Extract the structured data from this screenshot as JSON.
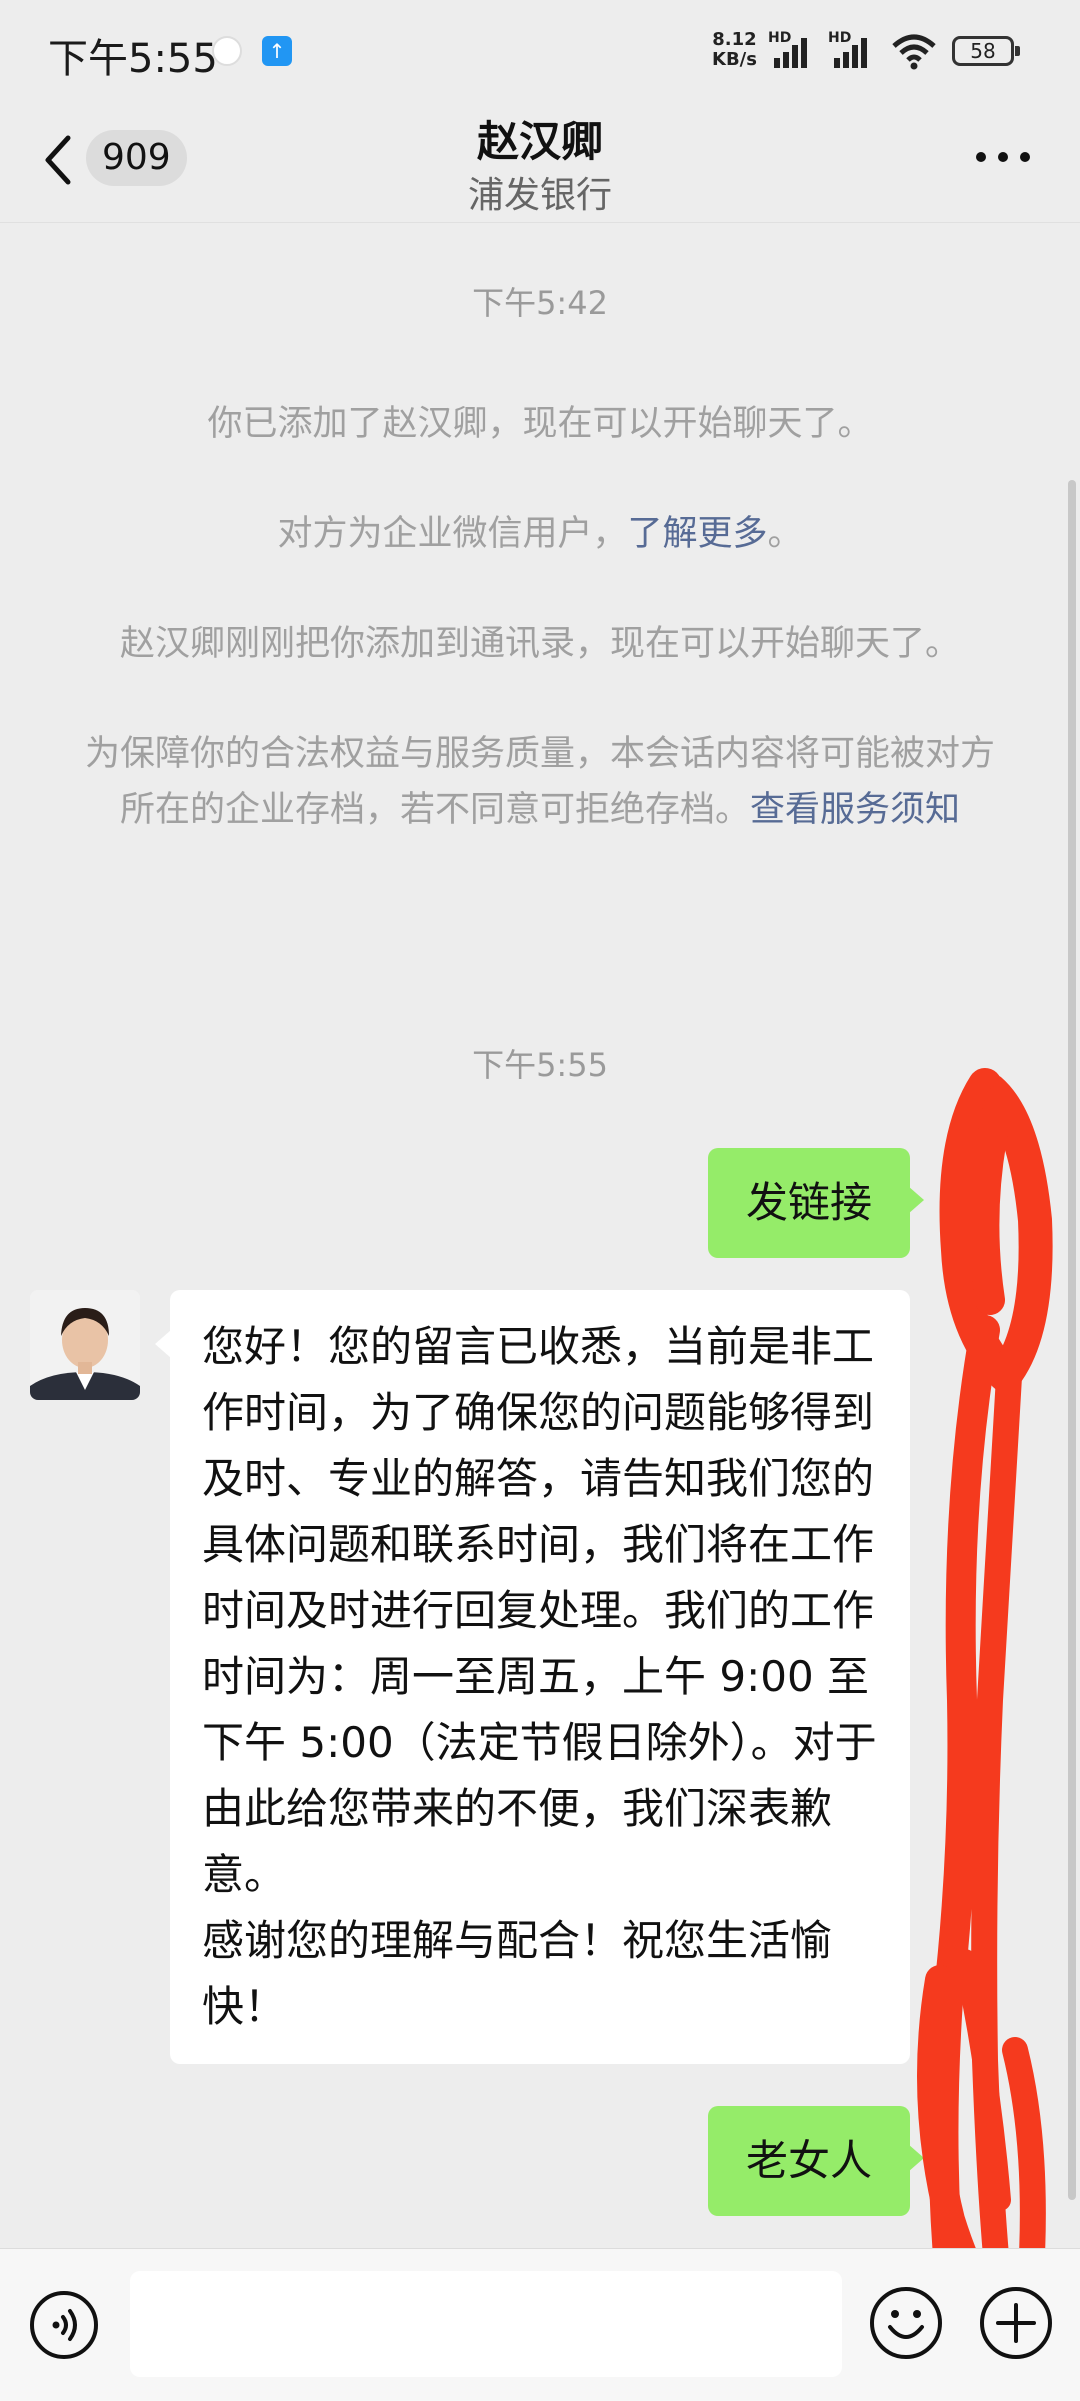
{
  "status_bar": {
    "time": "下午5:55",
    "net_speed_value": "8.12",
    "net_speed_unit": "KB/s",
    "hd1": "HD",
    "hd2": "HD",
    "battery": "58"
  },
  "header": {
    "back_icon": "chevron-left-icon",
    "unread_count": "909",
    "title": "赵汉卿",
    "subtitle": "浦发银行",
    "more_icon": "more-horizontal-icon"
  },
  "messages": {
    "timestamp_1": "下午5:42",
    "sys_added": "你已添加了赵汉卿，现在可以开始聊天了。",
    "sys_enterprise_prefix": "对方为企业微信用户，",
    "sys_enterprise_link": "了解更多",
    "sys_enterprise_suffix": "。",
    "sys_contact": "赵汉卿刚刚把你添加到通讯录，现在可以开始聊天了。",
    "sys_archive_text": "为保障你的合法权益与服务质量，本会话内容将可能被对方所在的企业存档，若不同意可拒绝存档。",
    "sys_archive_link": "查看服务须知",
    "timestamp_2": "下午5:55",
    "out_1": "发链接",
    "in_1": "您好！您的留言已收悉，当前是非工作时间，为了确保您的问题能够得到及时、专业的解答，请告知我们您的具体问题和联系时间，我们将在工作时间及时进行回复处理。我们的工作时间为：周一至周五，上午 9:00 至下午 5:00（法定节假日除外）。对于由此给您带来的不便，我们深表歉意。\n感谢您的理解与配合！祝您生活愉快！",
    "out_2": "老女人"
  },
  "input_bar": {
    "voice_icon": "voice-icon",
    "text_value": "",
    "emoji_icon": "emoji-icon",
    "plus_icon": "plus-circle-icon"
  },
  "colors": {
    "background": "#ededed",
    "outgoing_bubble": "#95ec69",
    "incoming_bubble": "#ffffff",
    "link": "#576b95",
    "scribble": "#f53a1e"
  }
}
